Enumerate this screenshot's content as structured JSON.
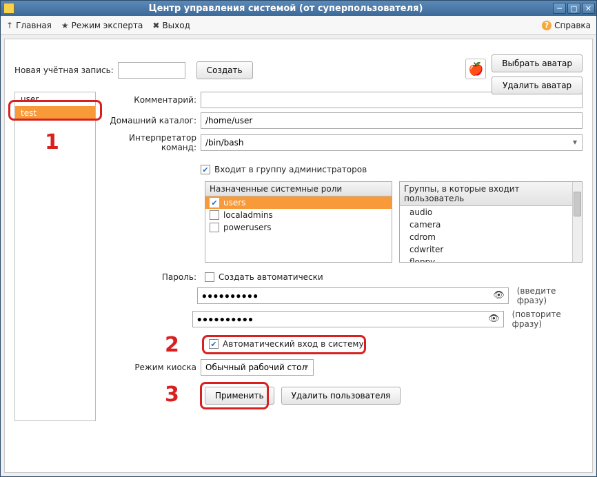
{
  "window": {
    "title": "Центр управления системой (от суперпользователя)"
  },
  "toolbar": {
    "main": "Главная",
    "expert": "Режим эксперта",
    "exit": "Выход",
    "help": "Справка"
  },
  "new_account": {
    "label": "Новая учётная запись:",
    "value": "",
    "create_btn": "Создать"
  },
  "avatar": {
    "select_btn": "Выбрать аватар",
    "delete_btn": "Удалить аватар",
    "icon_glyph": "🍎"
  },
  "user_list": [
    "user",
    "test"
  ],
  "user_selected": "test",
  "form": {
    "comment_label": "Комментарий:",
    "comment_value": "",
    "home_label": "Домашний каталог:",
    "home_value": "/home/user",
    "shell_label": "Интерпретатор команд:",
    "shell_value": "/bin/bash",
    "admin_group_label": "Входит в группу администраторов",
    "admin_group_checked": true
  },
  "roles": {
    "header": "Назначенные системные роли",
    "items": [
      {
        "name": "users",
        "checked": true,
        "selected": true
      },
      {
        "name": "localadmins",
        "checked": false,
        "selected": false
      },
      {
        "name": "powerusers",
        "checked": false,
        "selected": false
      }
    ]
  },
  "groups": {
    "header": "Группы, в которые входит пользователь",
    "items": [
      "audio",
      "camera",
      "cdrom",
      "cdwriter",
      "floppy"
    ]
  },
  "password": {
    "label": "Пароль:",
    "auto_label": "Создать автоматически",
    "auto_checked": false,
    "enter_hint": "(введите фразу)",
    "repeat_hint": "(повторите фразу)",
    "mask1": "●●●●●●●●●●",
    "mask2": "●●●●●●●●●●"
  },
  "auto_login": {
    "label": "Автоматический вход в систему",
    "checked": true
  },
  "kiosk": {
    "label": "Режим киоска",
    "value": "Обычный рабочий стол"
  },
  "actions": {
    "apply": "Применить",
    "delete_user": "Удалить пользователя"
  },
  "annotations": {
    "n1": "1",
    "n2": "2",
    "n3": "3"
  }
}
